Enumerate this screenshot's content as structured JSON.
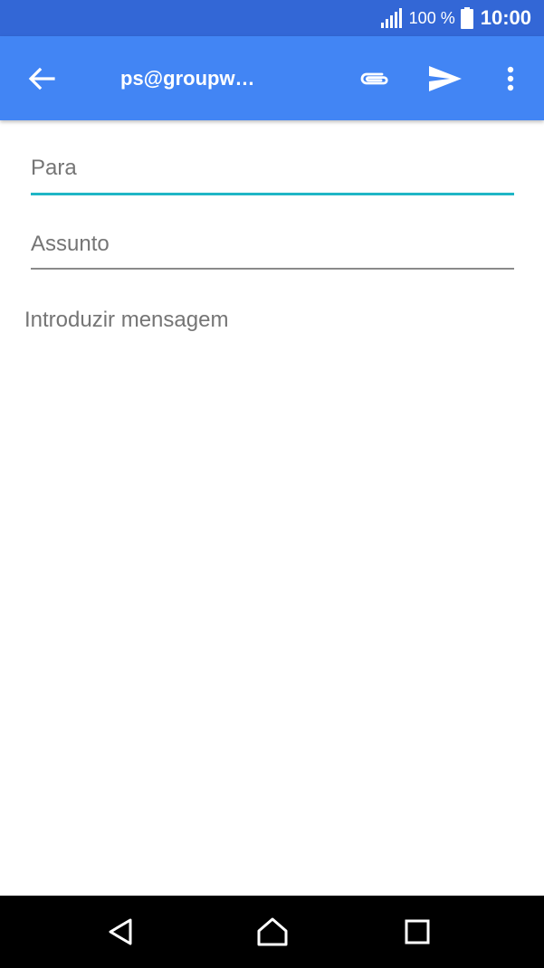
{
  "status_bar": {
    "battery_text": "100 %",
    "time": "10:00",
    "icons": [
      "signal-icon",
      "battery-icon"
    ]
  },
  "app_bar": {
    "title": "ps@groupw…",
    "icons": [
      "back-arrow-icon",
      "paperclip-icon",
      "send-icon",
      "more-vert-icon"
    ]
  },
  "compose": {
    "to_placeholder": "Para",
    "subject_placeholder": "Assunto",
    "message_placeholder": "Introduzir mensagem"
  },
  "nav_bar": {
    "icons": [
      "nav-back-icon",
      "nav-home-icon",
      "nav-recent-icon"
    ]
  },
  "colors": {
    "status_bar": "#3367d6",
    "app_bar": "#4285f4",
    "focus_underline": "#1fb6c6",
    "placeholder_text": "#757575",
    "nav_bar": "#000000"
  }
}
